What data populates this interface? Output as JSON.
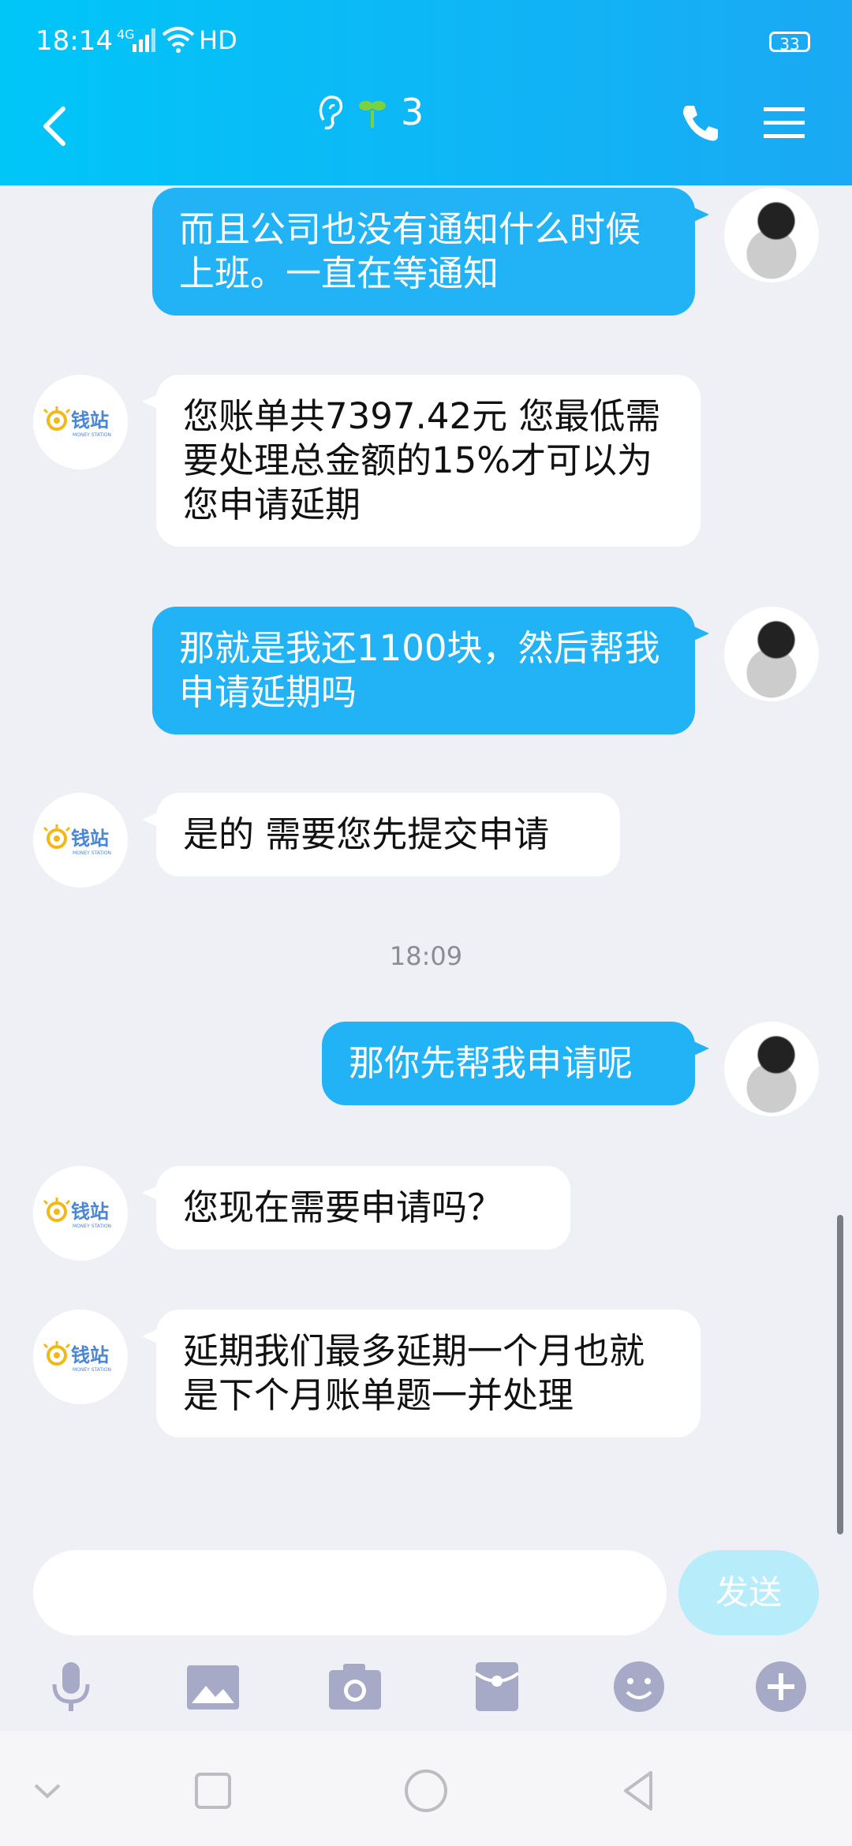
{
  "status_bar": {
    "time": "18:14",
    "network": "4G",
    "hd": "HD",
    "battery": "33"
  },
  "header": {
    "title_count": "3",
    "icons": [
      "back-icon",
      "ear-icon",
      "sprout-icon",
      "phone-icon",
      "menu-icon"
    ]
  },
  "messages": [
    {
      "from": "me",
      "text": "而且公司也没有通知什么时候上班。一直在等通知"
    },
    {
      "from": "other",
      "text": "您账单共7397.42元 您最低需要处理总金额的15%才可以为您申请延期"
    },
    {
      "from": "me",
      "text": "那就是我还1100块，然后帮我申请延期吗"
    },
    {
      "from": "other",
      "text": "是的 需要您先提交申请"
    },
    {
      "timestamp": "18:09"
    },
    {
      "from": "me",
      "text": "那你先帮我申请呢"
    },
    {
      "from": "other",
      "text": "您现在需要申请吗？"
    },
    {
      "from": "other",
      "text": "延期我们最多延期一个月也就是下个月账单题一并处理"
    }
  ],
  "brand_logo": {
    "text": "钱站",
    "sub_text": "MONEY STATION",
    "color": "#4a86d8",
    "accent": "#f2b817"
  },
  "input": {
    "placeholder": "",
    "send_label": "发送"
  },
  "toolbar": [
    "mic-icon",
    "image-icon",
    "camera-icon",
    "red-packet-icon",
    "emoji-icon",
    "plus-icon"
  ],
  "navbar": [
    "down-chevron-icon",
    "square-icon",
    "circle-icon",
    "back-triangle-icon"
  ]
}
